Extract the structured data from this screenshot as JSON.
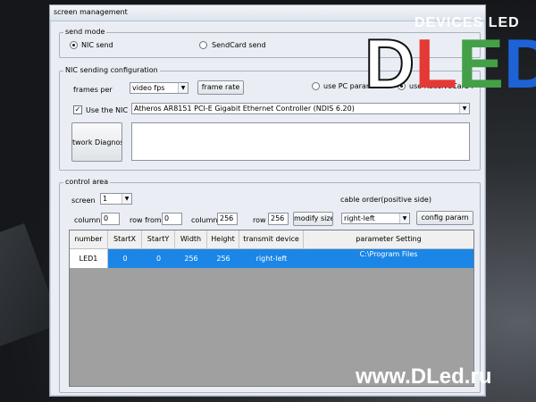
{
  "window": {
    "title": "screen management"
  },
  "send_mode": {
    "title": "send mode",
    "nic_send": "NIC send",
    "sendcard_send": "SendCard send"
  },
  "nic_config": {
    "title": "NIC sending configuration",
    "frames_per_label": "frames per",
    "frames_per_value": "video fps",
    "frame_rate_button": "frame rate",
    "use_pc_params": "use PC parameters",
    "use_receivecard": "use ReceiveCard P",
    "use_nic_label": "Use the NIC",
    "use_nic_checked": "✓",
    "nic_select_value": "Atheros AR8151 PCI-E Gigabit Ethernet Controller (NDIS 6.20)",
    "network_diag_button": "twork Diagnost"
  },
  "control_area": {
    "title": "control area",
    "screen_label": "screen",
    "screen_value": "1",
    "cable_order_label": "cable order(positive side)",
    "column_label": "column",
    "column_value": "0",
    "row_from_label": "row from",
    "row_from_value": "0",
    "column2_label": "column",
    "column2_value": "256",
    "row_label": "row",
    "row_value": "256",
    "modify_size_button": "modify size",
    "cable_order_value": "right-left",
    "config_param_button": "config param"
  },
  "table": {
    "headers": [
      "number",
      "StartX",
      "StartY",
      "Width",
      "Height",
      "transmit device",
      "parameter Setting"
    ],
    "rows": [
      {
        "number": "LED1",
        "startx": "0",
        "starty": "0",
        "width": "256",
        "height": "256",
        "transmit": "right-left",
        "param": "C:\\Program Files"
      }
    ]
  },
  "branding": {
    "logo_top": "DEVICES LED",
    "logo_big": "DLED",
    "watermark": "www.DLed.ru"
  }
}
